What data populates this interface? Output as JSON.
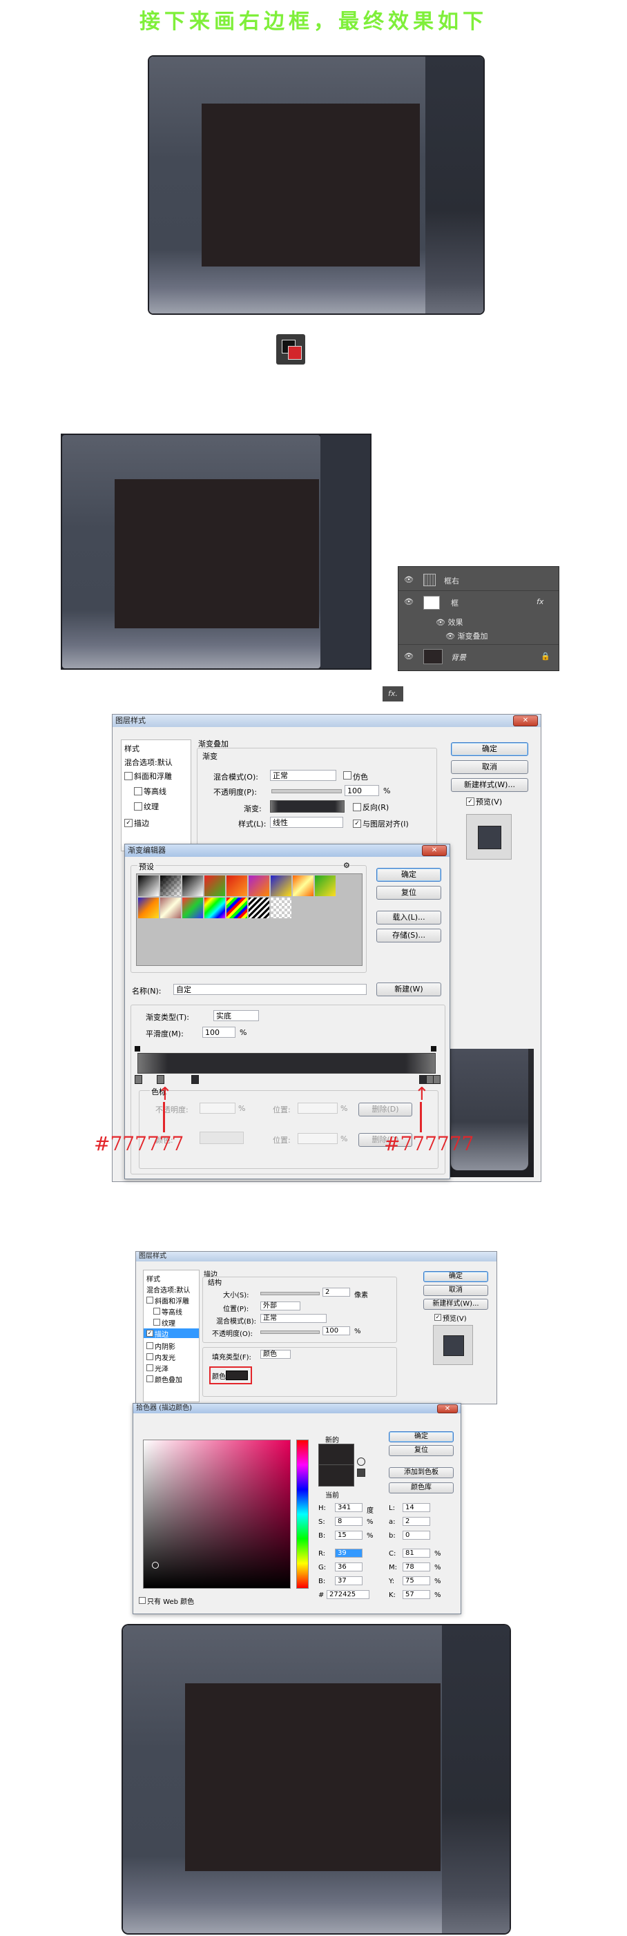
{
  "headline": "接下来画右边框，最终效果如下",
  "layers_panel": {
    "layers": [
      {
        "name": "框右"
      },
      {
        "name": "框",
        "fx": "fx"
      },
      {
        "name": "效果"
      },
      {
        "name": "渐变叠加"
      },
      {
        "name": "背景"
      }
    ]
  },
  "fx_badge": "fx.",
  "layer_style_1": {
    "title": "图层样式",
    "left_items": [
      "样式",
      "混合选项:默认",
      "斜面和浮雕",
      "等高线",
      "纹理",
      "描边"
    ],
    "section": "渐变叠加",
    "subsection": "渐变",
    "blend_mode_label": "混合模式(O):",
    "blend_mode_value": "正常",
    "dither_label": "仿色",
    "opacity_label": "不透明度(P):",
    "opacity_value": "100",
    "pct": "%",
    "gradient_label": "渐变:",
    "reverse_label": "反向(R)",
    "style_label": "样式(L):",
    "style_value": "线性",
    "align_label": "与图层对齐(I)",
    "ok": "确定",
    "cancel": "取消",
    "new_style": "新建样式(W)...",
    "preview": "预览(V)"
  },
  "gradient_editor": {
    "title": "渐变编辑器",
    "presets_label": "预设",
    "ok": "确定",
    "reset": "复位",
    "load": "载入(L)...",
    "save": "存储(S)...",
    "name_label": "名称(N):",
    "name_value": "自定",
    "new_btn": "新建(W)",
    "type_label": "渐变类型(T):",
    "type_value": "实底",
    "smooth_label": "平滑度(M):",
    "smooth_value": "100",
    "pct": "%",
    "stops_label": "色标",
    "opacity_label": "不透明度:",
    "location_label": "位置:",
    "delete_label": "删除(D)",
    "color_label": "颜色:",
    "annotation_left": "#777777",
    "annotation_right": "#777777"
  },
  "layer_style_2": {
    "title": "图层样式",
    "left_items": [
      "样式",
      "混合选项:默认",
      "斜面和浮雕",
      "等高线",
      "纹理",
      "描边",
      "内阴影",
      "内发光",
      "光泽",
      "颜色叠加"
    ],
    "section": "描边",
    "subsection": "结构",
    "size_label": "大小(S):",
    "size_value": "2",
    "size_unit": "像素",
    "position_label": "位置(P):",
    "position_value": "外部",
    "blend_label": "混合模式(B):",
    "blend_value": "正常",
    "opacity_label": "不透明度(O):",
    "opacity_value": "100",
    "pct": "%",
    "fill_type_label": "填充类型(F):",
    "fill_type_value": "颜色",
    "color_label": "颜色:",
    "ok": "确定",
    "cancel": "取消",
    "new_style": "新建样式(W)...",
    "preview": "预览(V)"
  },
  "color_picker": {
    "title": "拾色器 (描边颜色)",
    "new_label": "新的",
    "current_label": "当前",
    "ok": "确定",
    "reset": "复位",
    "add_swatch": "添加到色板",
    "libraries": "颜色库",
    "web_only": "只有 Web 颜色",
    "hex": "272425",
    "fields_left": [
      {
        "k": "H:",
        "v": "341",
        "u": "度"
      },
      {
        "k": "S:",
        "v": "8",
        "u": "%"
      },
      {
        "k": "B:",
        "v": "15",
        "u": "%"
      },
      {
        "k": "R:",
        "v": "39",
        "u": ""
      },
      {
        "k": "G:",
        "v": "36",
        "u": ""
      },
      {
        "k": "B:",
        "v": "37",
        "u": ""
      }
    ],
    "fields_right": [
      {
        "k": "L:",
        "v": "14",
        "u": ""
      },
      {
        "k": "a:",
        "v": "2",
        "u": ""
      },
      {
        "k": "b:",
        "v": "0",
        "u": ""
      },
      {
        "k": "C:",
        "v": "81",
        "u": "%"
      },
      {
        "k": "M:",
        "v": "78",
        "u": "%"
      },
      {
        "k": "Y:",
        "v": "75",
        "u": "%"
      },
      {
        "k": "K:",
        "v": "57",
        "u": "%"
      }
    ],
    "hash": "#"
  },
  "colors": {
    "headline": "#7fef3a",
    "tablet_body": "#444a56",
    "tablet_screen": "#272021",
    "tablet_right": "#2f333d",
    "annotation": "#e3262b",
    "stroke_color": "#272425"
  }
}
